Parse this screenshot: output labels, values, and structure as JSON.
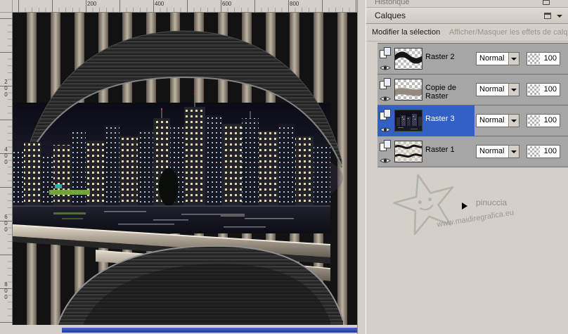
{
  "rulers": {
    "h": [
      "200",
      "400",
      "600",
      "800"
    ],
    "v": [
      "200",
      "400",
      "600",
      "800"
    ]
  },
  "panel": {
    "history_title": "Historique",
    "title": "Calques",
    "modify_selection": "Modifier la sélection",
    "toggle_effects": "Afficher/Masquer les effets de calq",
    "layers": [
      {
        "name": "Raster 2",
        "blend": "Normal",
        "opacity": "100",
        "selected": false,
        "visible": true
      },
      {
        "name": "Copie de Raster",
        "blend": "Normal",
        "opacity": "100",
        "selected": false,
        "visible": true
      },
      {
        "name": "Raster 3",
        "blend": "Normal",
        "opacity": "100",
        "selected": true,
        "visible": true
      },
      {
        "name": "Raster 1",
        "blend": "Normal",
        "opacity": "100",
        "selected": false,
        "visible": true
      }
    ]
  },
  "watermark": {
    "name": "pinuccia",
    "site": "www.maidiregrafica.eu"
  },
  "colors": {
    "chrome": "#d4d0c8",
    "selection_blue": "#3161c4",
    "row_gray": "#a6a6a6",
    "stripe_tan": "#b0a494",
    "canvas_black": "#121212"
  }
}
